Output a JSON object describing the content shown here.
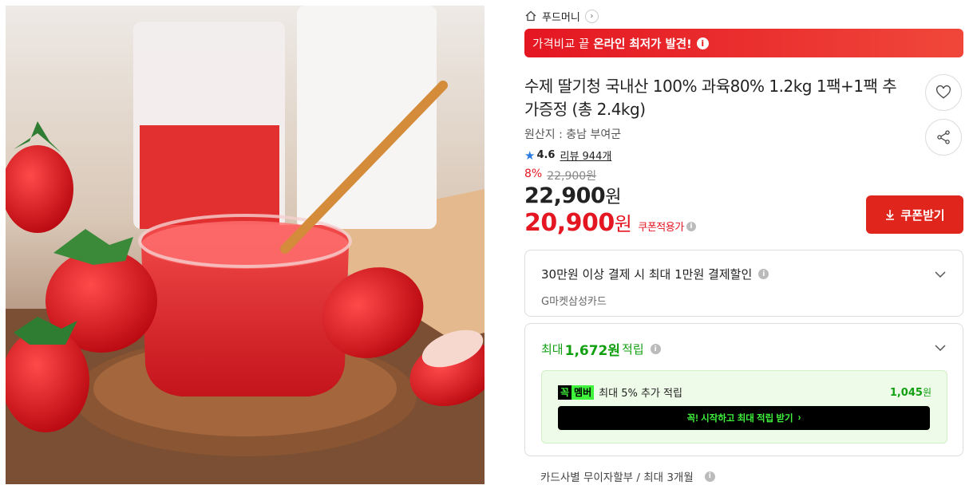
{
  "shop": {
    "name": "푸드머니",
    "arrow": "›"
  },
  "banner": {
    "light": "가격비교 끝",
    "bold": "온라인 최저가 발견!",
    "info": "i"
  },
  "product": {
    "title": "수제 딸기청 국내산 100% 과육80% 1.2kg 1팩+1팩 추가증정 (총 2.4kg)",
    "origin": "원산지 : 충남 부여군",
    "rating": "4.6",
    "review_label": "리뷰 944개",
    "discount_rate": "8%",
    "original_price": "22,900원",
    "price_number": "22,900",
    "price_unit": "원",
    "coupon_price_number": "20,900",
    "coupon_price_unit": "원",
    "coupon_note": "쿠폰적용가",
    "coupon_button": "쿠폰받기"
  },
  "card_offer": {
    "main": "30만원 이상 결제 시 최대 1만원 결제할인",
    "sub": "G마켓삼성카드"
  },
  "points": {
    "prefix": "최대",
    "amount": "1,672원",
    "suffix": "적립",
    "member_badge_a": "꼭",
    "member_badge_b": "멤버",
    "member_text": "최대 5% 추가 적립",
    "member_points": "1,045",
    "member_points_unit": "원",
    "member_cta": "꼭! 시작하고 최대 적립 받기",
    "member_cta_arrow": "›"
  },
  "installment": "카드사별 무이자할부 / 최대 3개월",
  "icons": {
    "wishlist": "heart-icon",
    "share": "share-icon"
  },
  "colors": {
    "accent_red": "#e41622",
    "point_green": "#12a012",
    "member_neon": "#3ff23b"
  }
}
